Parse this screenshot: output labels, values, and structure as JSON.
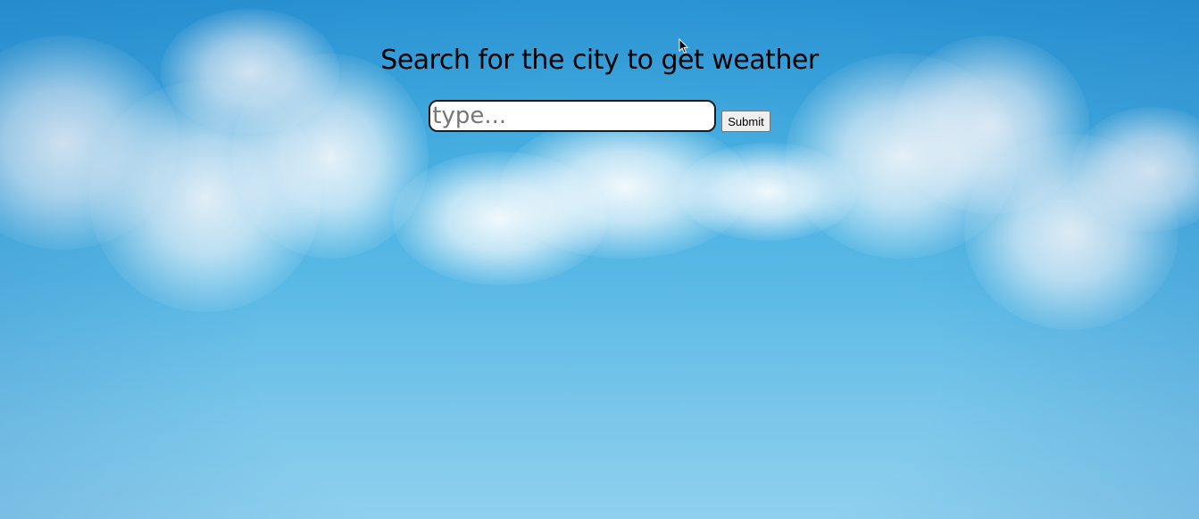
{
  "page": {
    "heading": "Search for the city to get weather"
  },
  "search": {
    "placeholder": "type...",
    "value": ""
  },
  "form": {
    "submit_label": "Submit"
  },
  "background": {
    "image": "sky-clouds-image",
    "sky_color": "#44ade0",
    "cloud_color": "#ffffff"
  },
  "pointer": {
    "icon": "mouse-cursor-icon"
  }
}
